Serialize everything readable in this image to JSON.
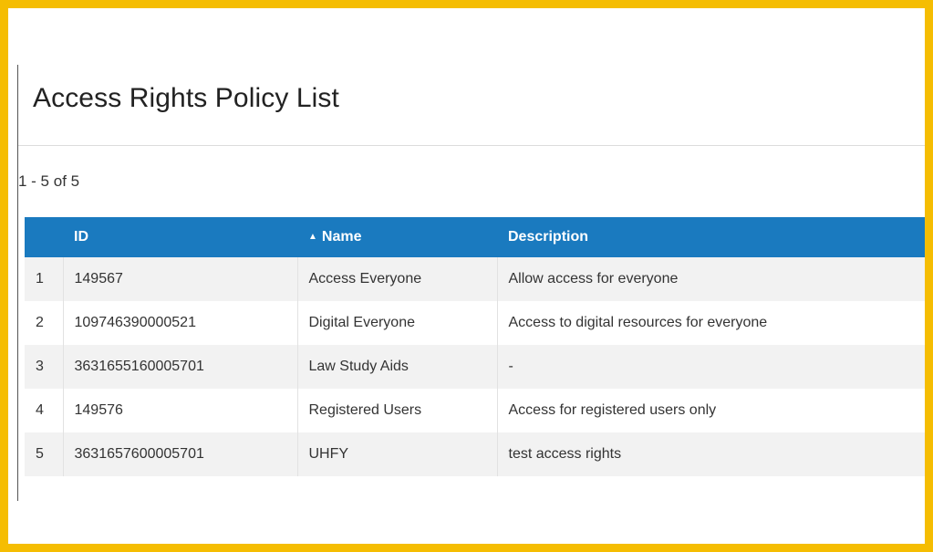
{
  "page": {
    "title": "Access Rights Policy List",
    "count_label": "1 - 5 of 5"
  },
  "table": {
    "columns": {
      "num": "",
      "id": "ID",
      "name": "Name",
      "description": "Description"
    },
    "sort": {
      "column": "name",
      "direction": "ascending",
      "indicator": "▲"
    },
    "rows": [
      {
        "num": "1",
        "id": "149567",
        "name": "Access Everyone",
        "description": "Allow access for everyone"
      },
      {
        "num": "2",
        "id": "109746390000521",
        "name": "Digital Everyone",
        "description": "Access to digital resources for everyone"
      },
      {
        "num": "3",
        "id": "3631655160005701",
        "name": "Law Study Aids",
        "description": "-"
      },
      {
        "num": "4",
        "id": "149576",
        "name": "Registered Users",
        "description": "Access for registered users only"
      },
      {
        "num": "5",
        "id": "3631657600005701",
        "name": "UHFY",
        "description": "test access rights"
      }
    ]
  },
  "colors": {
    "frame_border": "#f5bd02",
    "header_background": "#1a7abf",
    "row_stripe": "#f2f2f2"
  }
}
